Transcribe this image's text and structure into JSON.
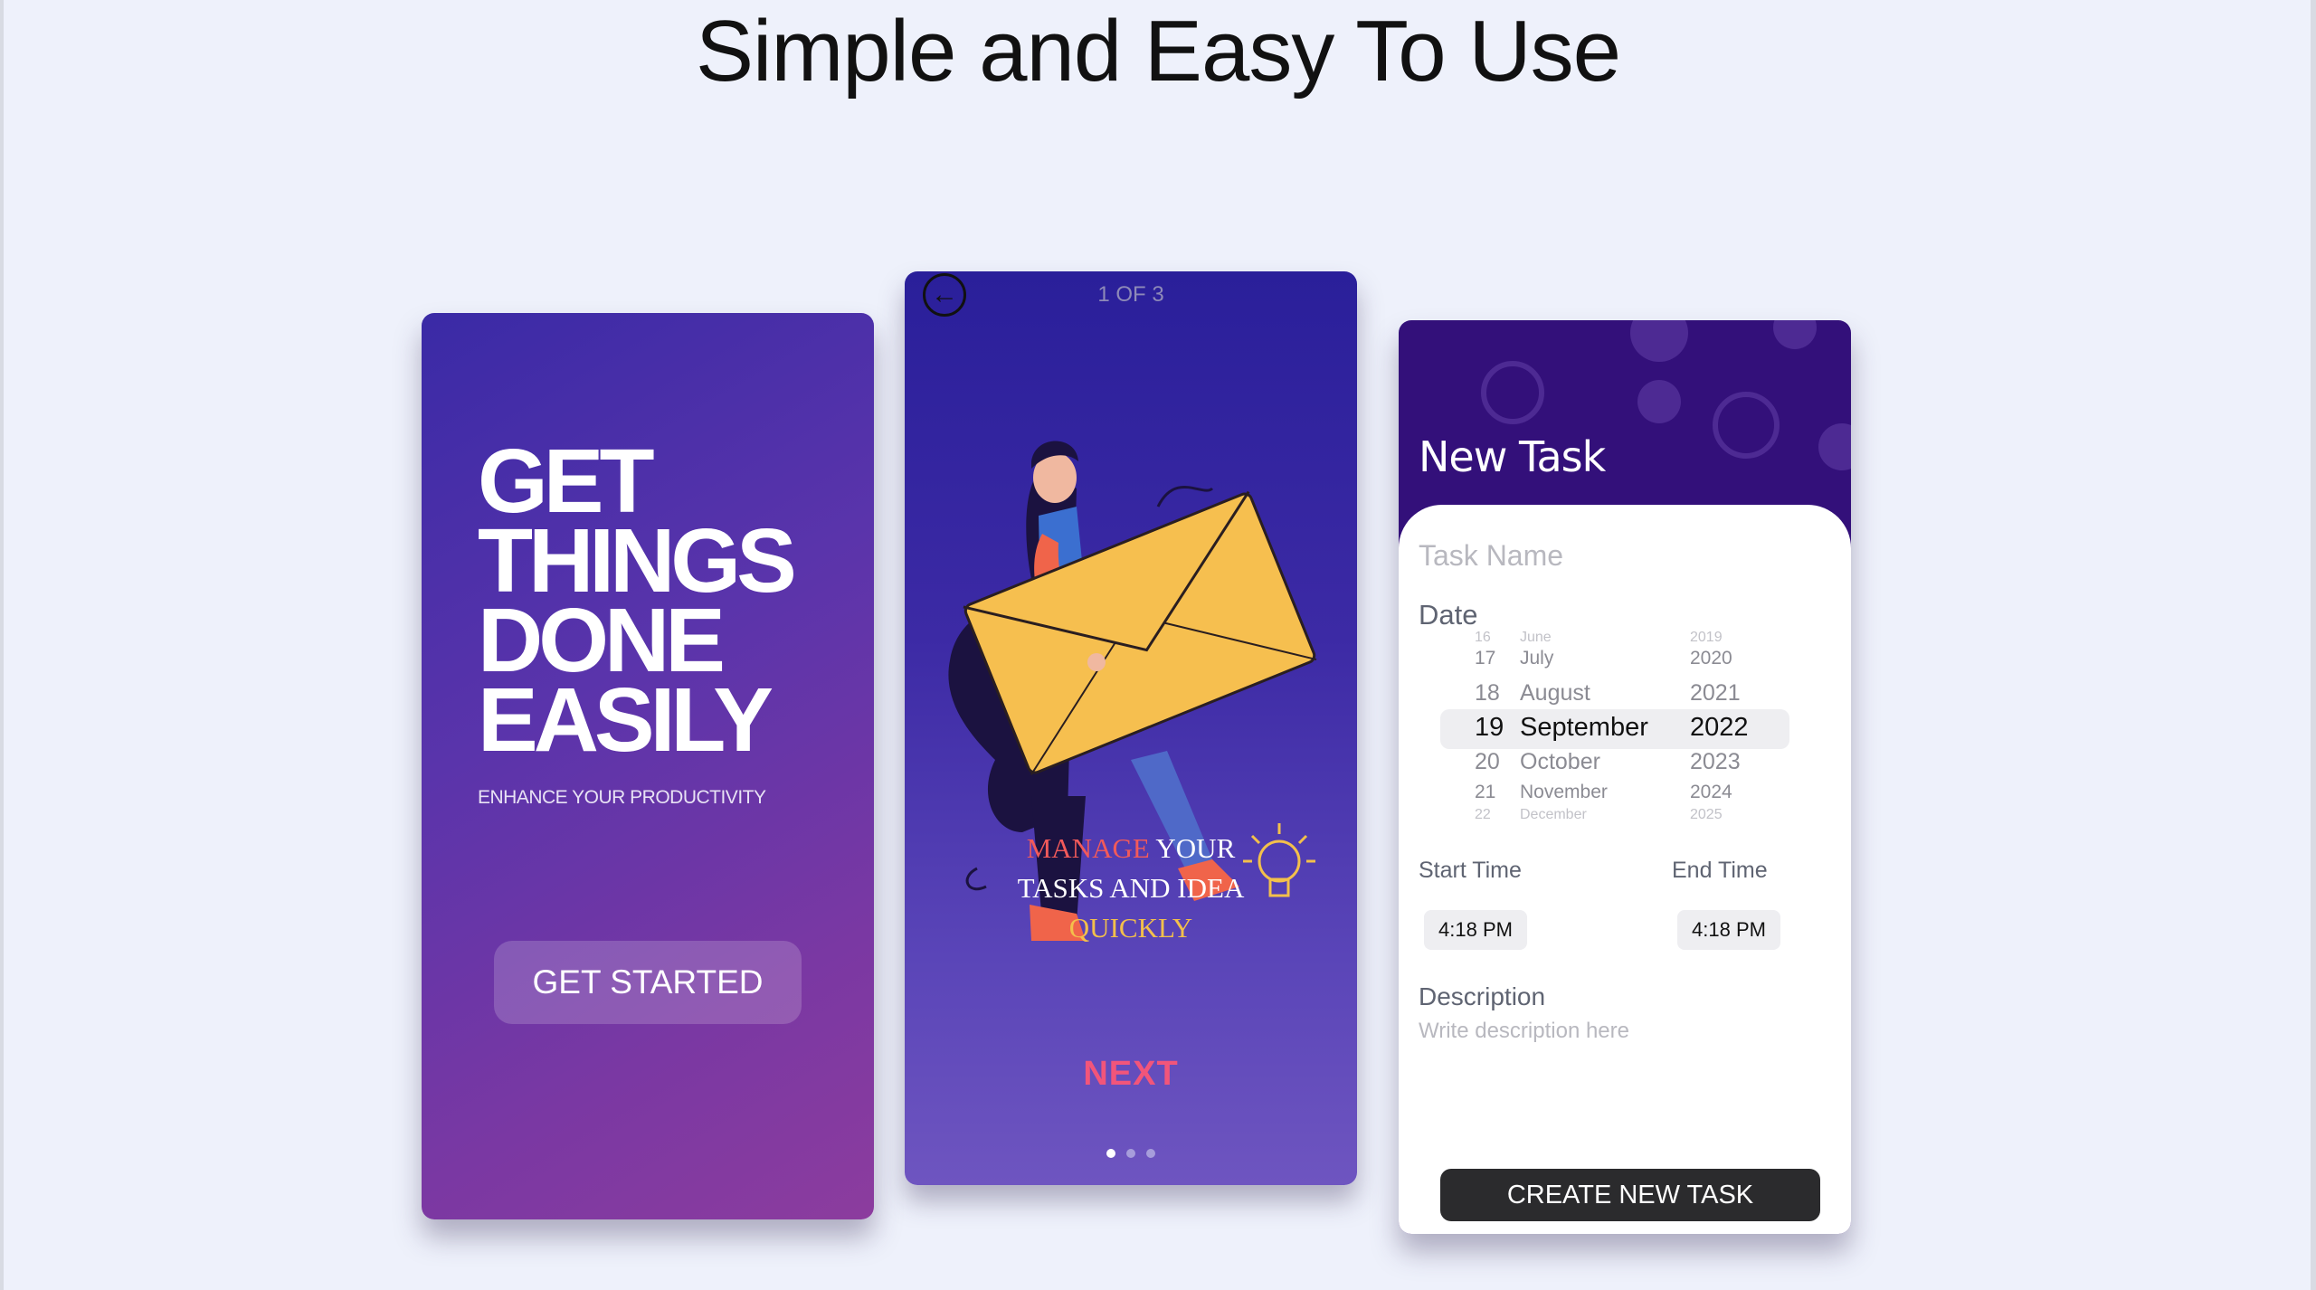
{
  "page": {
    "title": "Simple and Easy To Use"
  },
  "screen1": {
    "headline": [
      "GET",
      "THINGS",
      "DONE",
      "EASILY"
    ],
    "subtitle": "ENHANCE YOUR PRODUCTIVITY",
    "button_label": "GET STARTED"
  },
  "screen2": {
    "page_indicator": "1 OF 3",
    "text": {
      "manage": "MANAGE",
      "your": "YOUR",
      "line2": "TASKS AND IDEA",
      "line3": "QUICKLY"
    },
    "next_label": "NEXT",
    "dots": {
      "count": 3,
      "active_index": 0
    }
  },
  "screen3": {
    "title": "New Task",
    "task_name_placeholder": "Task Name",
    "date_label": "Date",
    "date_picker": {
      "rows": [
        {
          "day": "16",
          "month": "June",
          "year": "2019"
        },
        {
          "day": "17",
          "month": "July",
          "year": "2020"
        },
        {
          "day": "18",
          "month": "August",
          "year": "2021"
        },
        {
          "day": "19",
          "month": "September",
          "year": "2022"
        },
        {
          "day": "20",
          "month": "October",
          "year": "2023"
        },
        {
          "day": "21",
          "month": "November",
          "year": "2024"
        },
        {
          "day": "22",
          "month": "December",
          "year": "2025"
        }
      ],
      "selected_index": 3
    },
    "start_time_label": "Start Time",
    "end_time_label": "End Time",
    "start_time": "4:18 PM",
    "end_time": "4:18 PM",
    "description_label": "Description",
    "description_placeholder": "Write description here",
    "create_button_label": "CREATE NEW TASK"
  },
  "colors": {
    "background": "#eef1fb",
    "screen3_header": "#33107a",
    "next_accent": "#f2557a",
    "quickly_accent": "#f3c04b",
    "manage_accent": "#f25a5a",
    "create_button": "#2b2b2d"
  }
}
